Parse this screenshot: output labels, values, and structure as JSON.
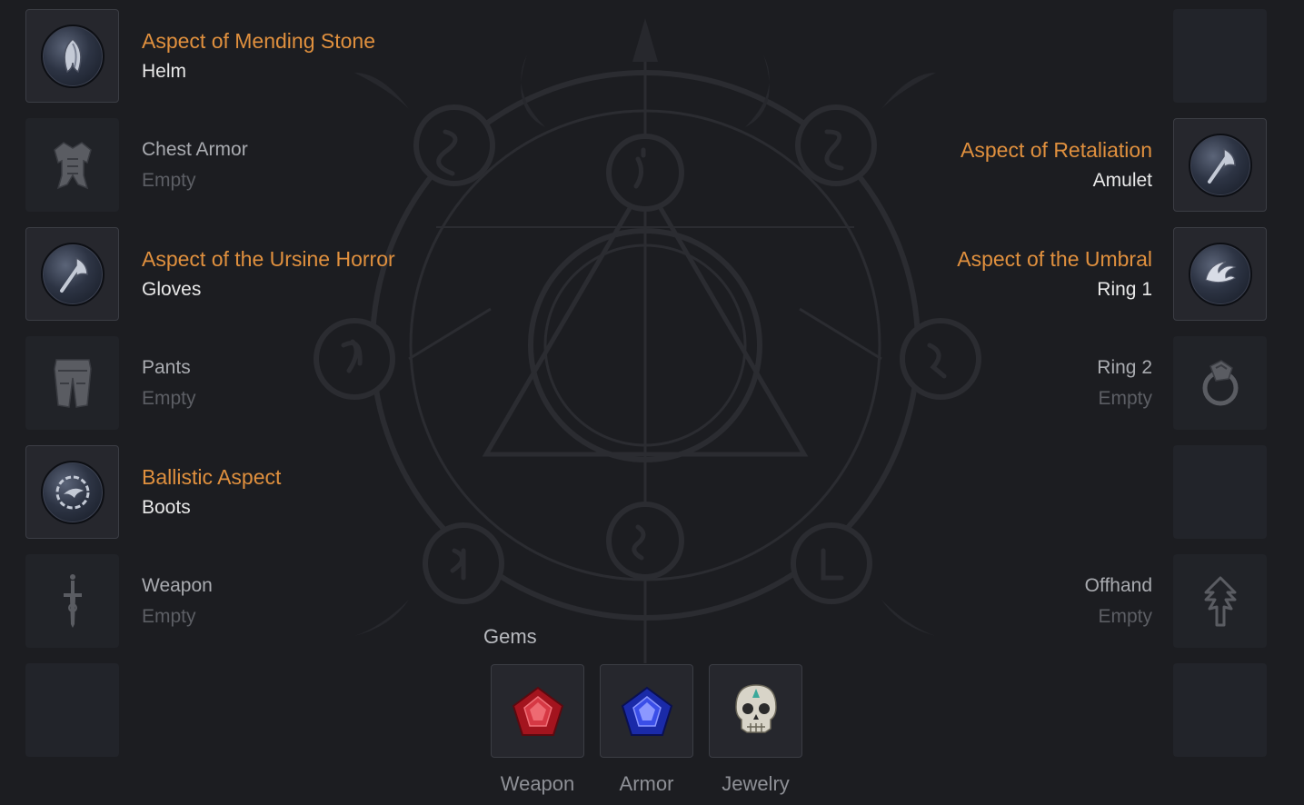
{
  "left_slots": [
    {
      "aspect": "Aspect of Mending Stone",
      "slot": "Helm",
      "status": "",
      "icon": "helm-aspect-icon"
    },
    {
      "aspect": "",
      "slot": "Chest Armor",
      "status": "Empty",
      "icon": "chest-armor-icon"
    },
    {
      "aspect": "Aspect of the Ursine Horror",
      "slot": "Gloves",
      "status": "",
      "icon": "gloves-aspect-icon"
    },
    {
      "aspect": "",
      "slot": "Pants",
      "status": "Empty",
      "icon": "pants-icon"
    },
    {
      "aspect": "Ballistic Aspect",
      "slot": "Boots",
      "status": "",
      "icon": "boots-aspect-icon"
    },
    {
      "aspect": "",
      "slot": "Weapon",
      "status": "Empty",
      "icon": "weapon-icon"
    }
  ],
  "right_slots": [
    {
      "aspect": "Aspect of Retaliation",
      "slot": "Amulet",
      "status": "",
      "icon": "amulet-aspect-icon"
    },
    {
      "aspect": "Aspect of the Umbral",
      "slot": "Ring 1",
      "status": "",
      "icon": "ring-aspect-icon"
    },
    {
      "aspect": "",
      "slot": "Ring 2",
      "status": "Empty",
      "icon": "ring-icon"
    },
    {
      "aspect": "",
      "slot": "Offhand",
      "status": "Empty",
      "icon": "offhand-icon"
    }
  ],
  "gems": {
    "title": "Gems",
    "items": [
      {
        "label": "Weapon",
        "icon": "ruby-gem-icon",
        "color": "#c0222c"
      },
      {
        "label": "Armor",
        "icon": "sapphire-gem-icon",
        "color": "#2a3ad8"
      },
      {
        "label": "Jewelry",
        "icon": "skull-gem-icon",
        "color": "#d8d4c8"
      }
    ]
  },
  "colors": {
    "background": "#1c1d21",
    "aspect_text": "#e0903e",
    "slot_text": "#e8e8e8",
    "empty_text": "#5c5e64"
  }
}
